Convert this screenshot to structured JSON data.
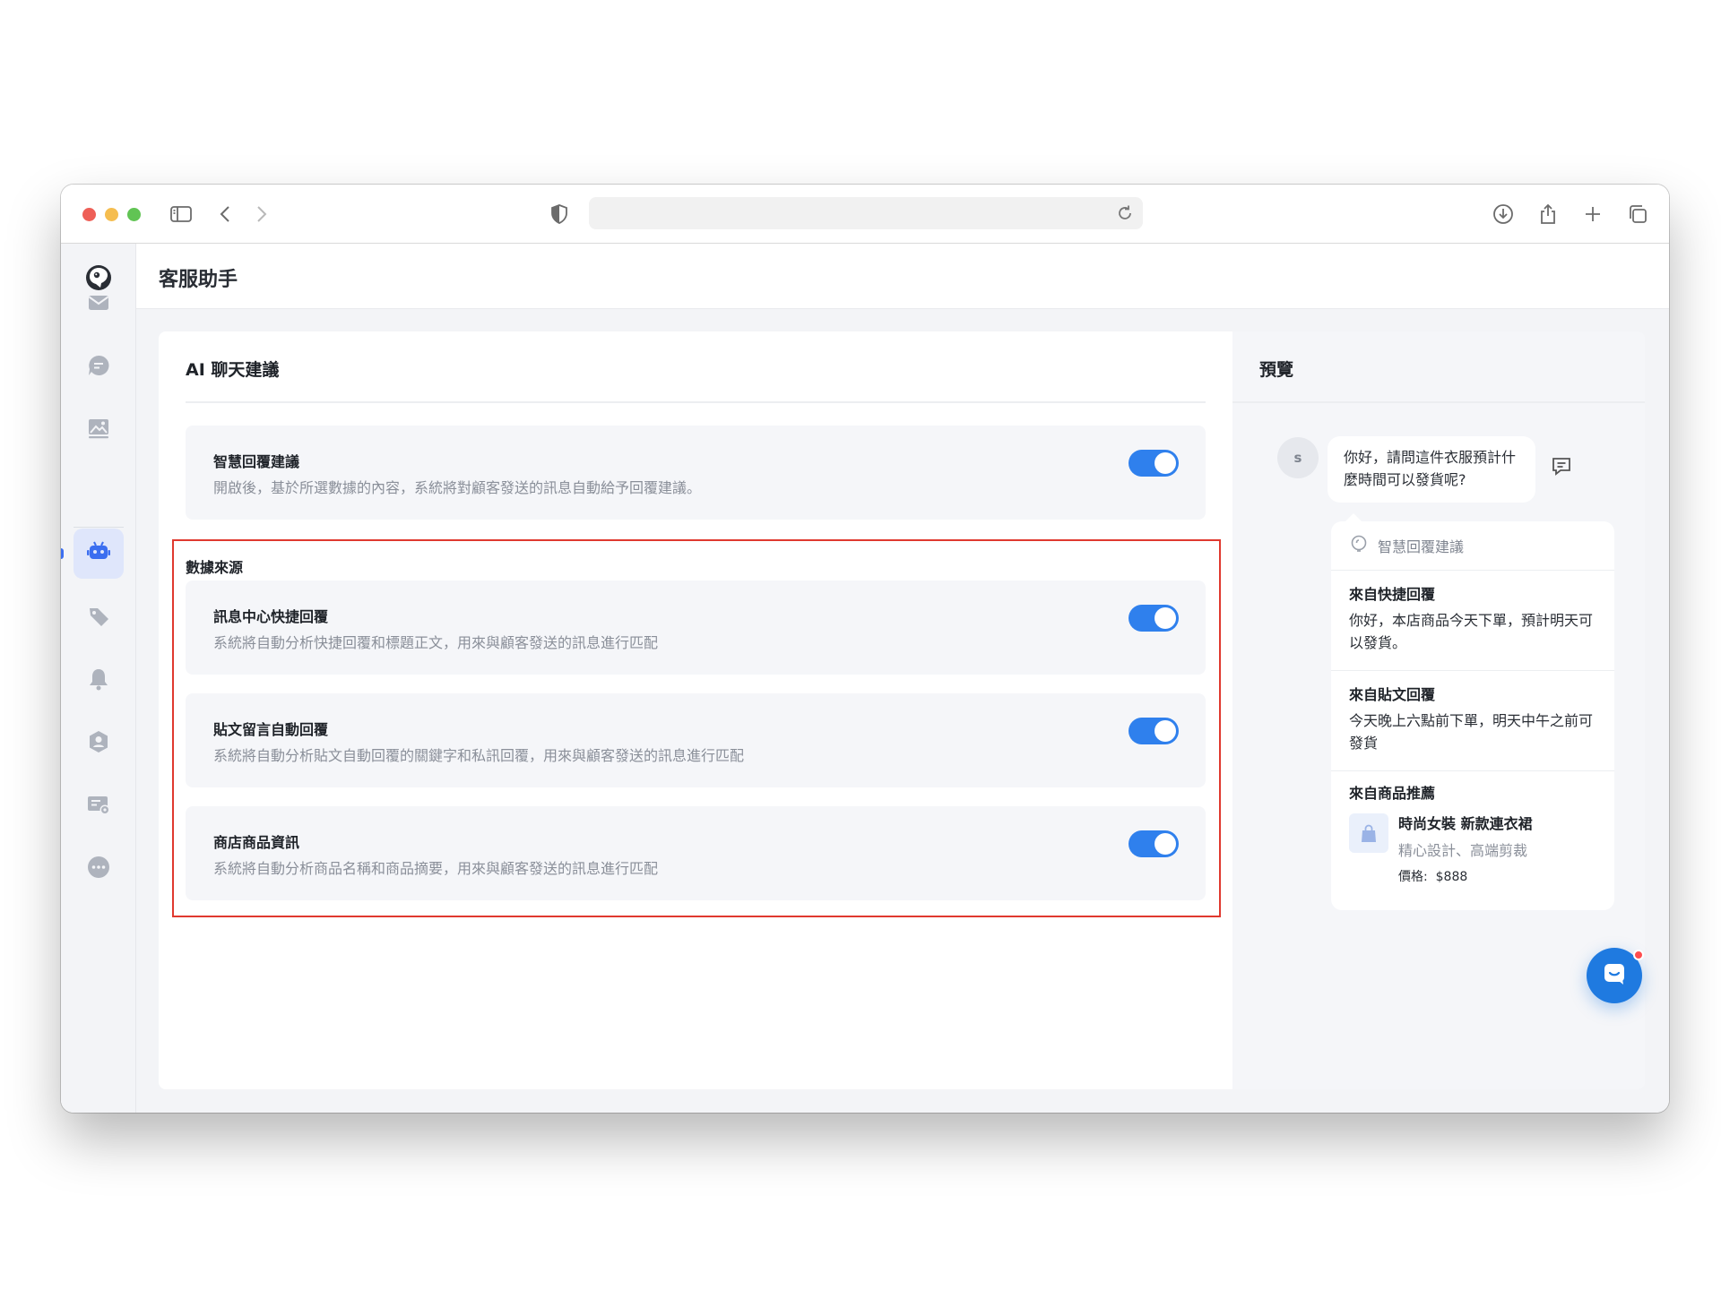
{
  "app": {
    "title": "客服助手"
  },
  "sidebar": {
    "items": [
      {
        "icon": "mail-icon"
      },
      {
        "icon": "chat-icon"
      },
      {
        "icon": "image-icon"
      },
      {
        "icon": "robot-icon",
        "active": true
      },
      {
        "icon": "tag-icon"
      },
      {
        "icon": "bell-icon"
      },
      {
        "icon": "user-shield-icon"
      },
      {
        "icon": "card-settings-icon"
      },
      {
        "icon": "more-icon"
      }
    ]
  },
  "main": {
    "title": "AI 聊天建議",
    "smart_reply": {
      "title": "智慧回覆建議",
      "desc": "開啟後，基於所選數據的內容，系統將對顧客發送的訊息自動給予回覆建議。",
      "enabled": true
    },
    "data_source": {
      "label": "數據來源",
      "items": [
        {
          "title": "訊息中心快捷回覆",
          "desc": "系統將自動分析快捷回覆和標題正文，用來與顧客發送的訊息進行匹配",
          "enabled": true
        },
        {
          "title": "貼文留言自動回覆",
          "desc": "系統將自動分析貼文自動回覆的關鍵字和私訊回覆，用來與顧客發送的訊息進行匹配",
          "enabled": true
        },
        {
          "title": "商店商品資訊",
          "desc": "系統將自動分析商品名稱和商品摘要，用來與顧客發送的訊息進行匹配",
          "enabled": true
        }
      ]
    }
  },
  "preview": {
    "title": "預覽",
    "avatar_letter": "s",
    "customer_message": "你好，請問這件衣服預計什麼時間可以發貨呢?",
    "suggestions_header": "智慧回覆建議",
    "quick_reply": {
      "title": "來自快捷回覆",
      "text": "你好，本店商品今天下單，預計明天可以發貨。"
    },
    "post_reply": {
      "title": "來自貼文回覆",
      "text": "今天晚上六點前下單，明天中午之前可發貨"
    },
    "product": {
      "title": "來自商品推薦",
      "name": "時尚女裝 新款連衣裙",
      "desc": "精心設計、高端剪裁",
      "price_label": "價格:",
      "price": "$888"
    }
  },
  "colors": {
    "accent": "#2f80ed",
    "highlight_border": "#e0392f",
    "fab": "#1f7ae0"
  }
}
